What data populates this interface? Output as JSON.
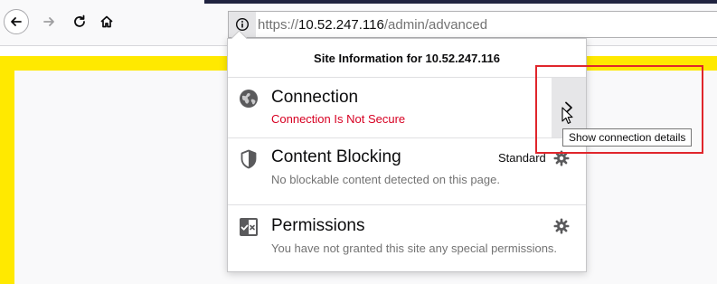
{
  "toolbar": {
    "back_icon": "back-arrow-icon",
    "forward_icon": "forward-arrow-icon",
    "reload_icon": "reload-icon",
    "home_icon": "home-icon"
  },
  "urlbar": {
    "info_icon": "info-icon",
    "scheme": "https://",
    "host": "10.52.247.116",
    "path": "/admin/advanced"
  },
  "panel": {
    "header": "Site Information for 10.52.247.116",
    "connection": {
      "icon": "globe-icon",
      "title": "Connection",
      "status": "Connection Is Not Secure",
      "expand_icon": "chevron-right-icon"
    },
    "content_blocking": {
      "icon": "shield-icon",
      "title": "Content Blocking",
      "mode": "Standard",
      "description": "No blockable content detected on this page.",
      "gear_icon": "gear-icon"
    },
    "permissions": {
      "icon": "permissions-icon",
      "title": "Permissions",
      "description": "You have not granted this site any special permissions.",
      "gear_icon": "gear-icon"
    }
  },
  "tooltip": {
    "text": "Show connection details"
  },
  "colors": {
    "insecure_red": "#d70022",
    "page_frame_yellow": "#ffe900",
    "highlight_red": "#e0262c",
    "text_gray": "#737373"
  }
}
